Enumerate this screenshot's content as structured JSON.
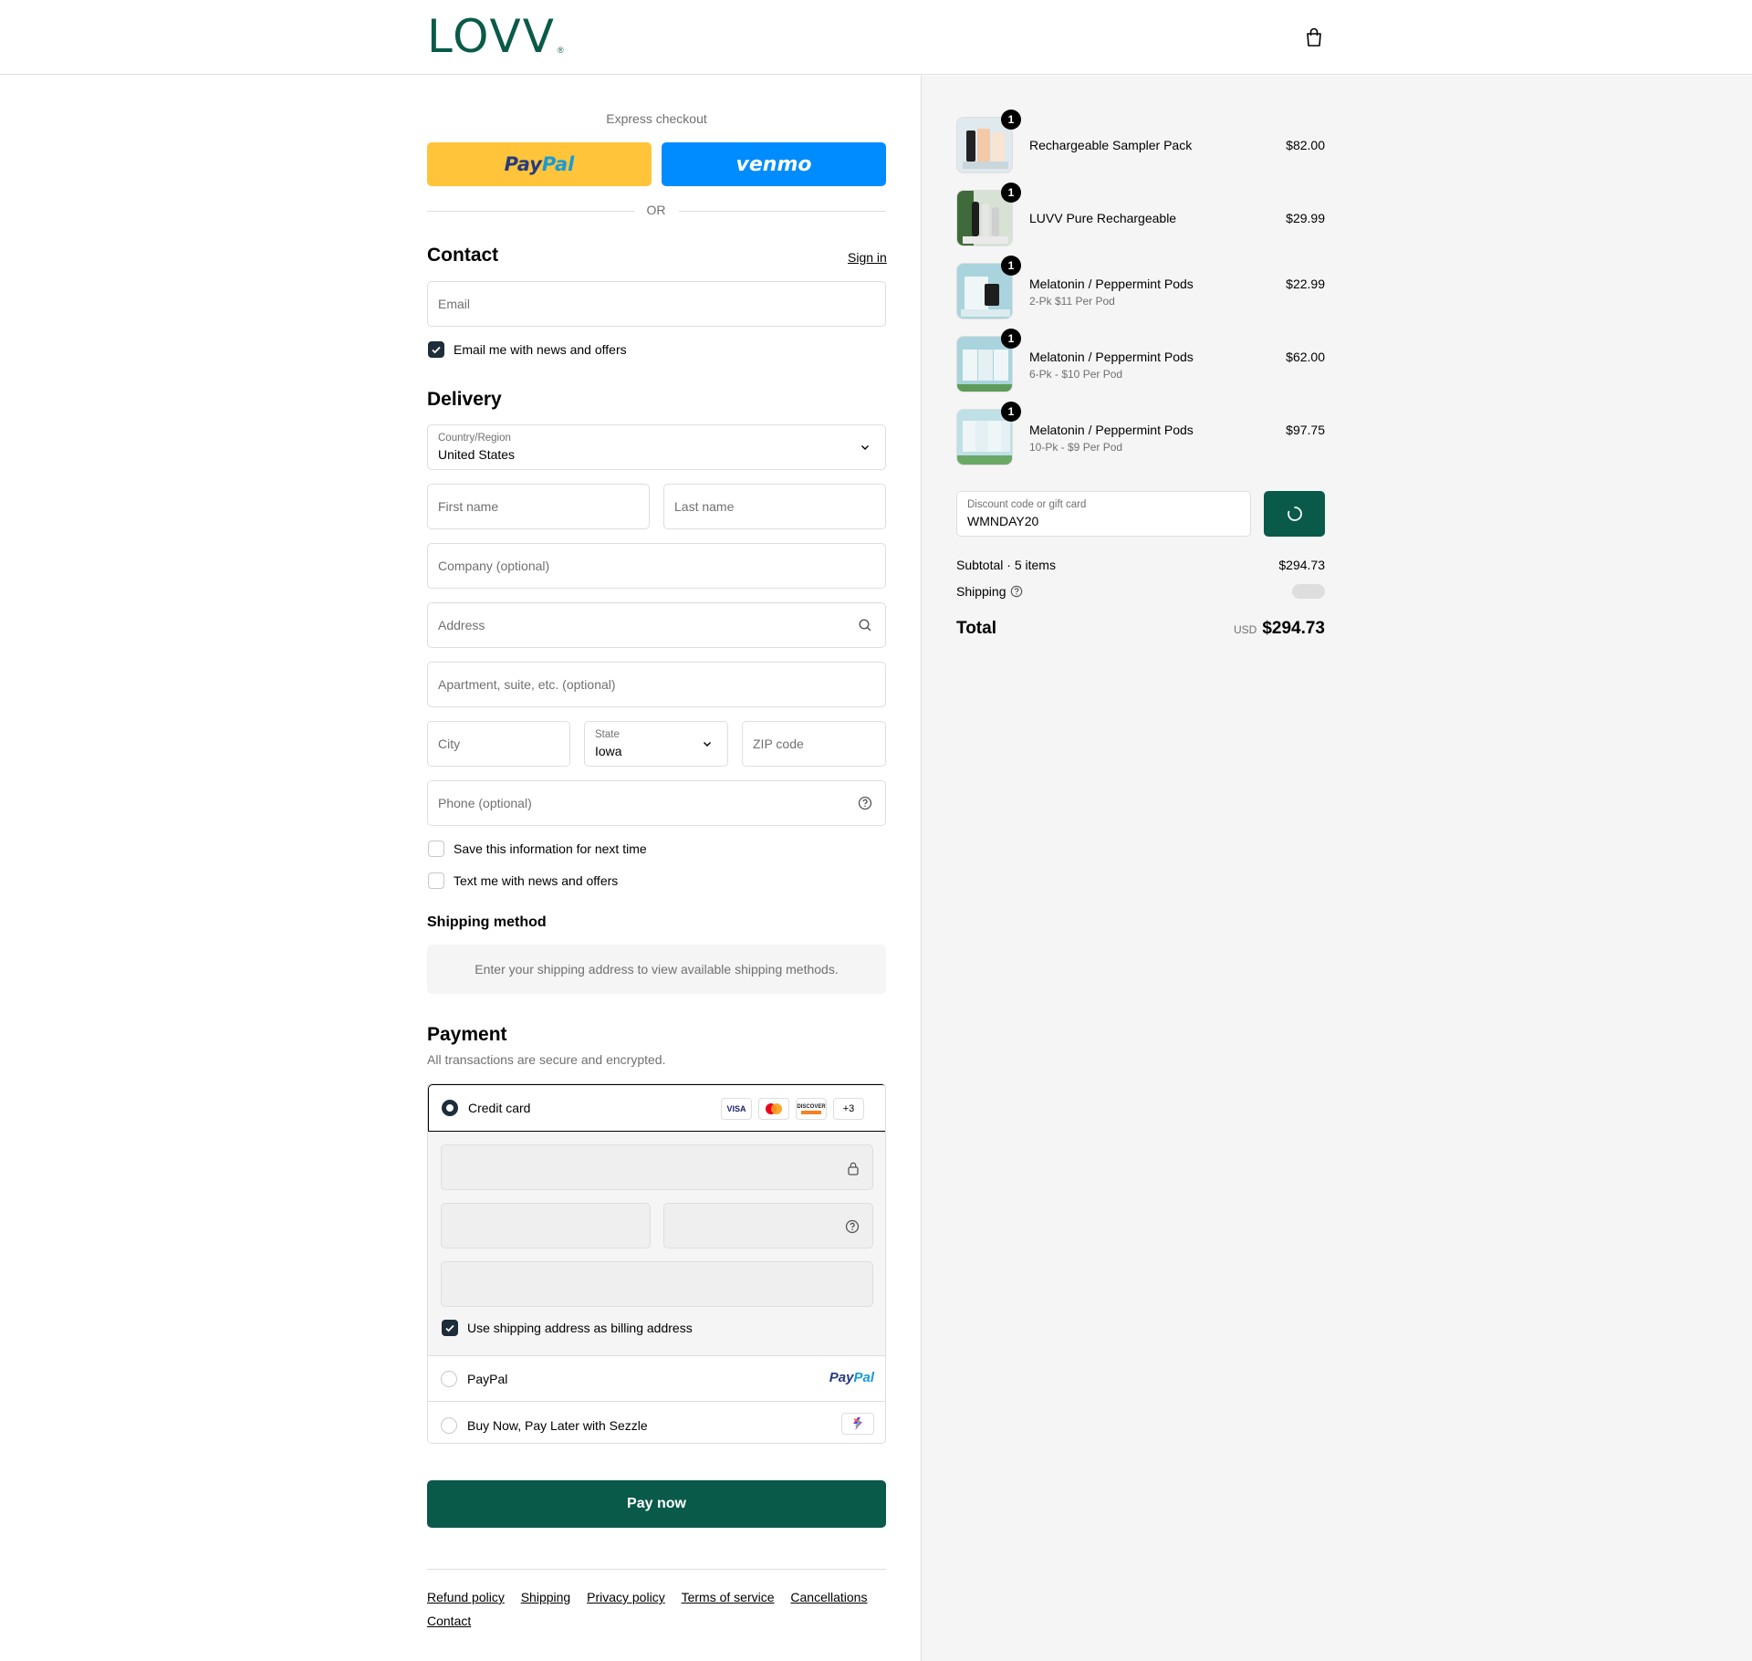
{
  "brand": {
    "logo": "LOVV",
    "reg": "®",
    "accent": "#0a5a49"
  },
  "express": {
    "title": "Express checkout",
    "paypal_a": "Pay",
    "paypal_b": "Pal",
    "venmo": "venmo",
    "or": "OR"
  },
  "contact": {
    "title": "Contact",
    "sign_in": "Sign in",
    "email_placeholder": "Email",
    "news_label": "Email me with news and offers"
  },
  "delivery": {
    "title": "Delivery",
    "country_label": "Country/Region",
    "country_value": "United States",
    "first_name": "First name",
    "last_name": "Last name",
    "company": "Company (optional)",
    "address": "Address",
    "apartment": "Apartment, suite, etc. (optional)",
    "city": "City",
    "state_label": "State",
    "state_value": "Iowa",
    "zip": "ZIP code",
    "phone": "Phone (optional)",
    "save_info": "Save this information for next time",
    "text_news": "Text me with news and offers"
  },
  "shipping_method": {
    "title": "Shipping method",
    "notice": "Enter your shipping address to view available shipping methods."
  },
  "payment": {
    "title": "Payment",
    "subtitle": "All transactions are secure and encrypted.",
    "credit_card": "Credit card",
    "brands": [
      "VISA",
      "",
      "DISCOVER",
      "+3"
    ],
    "billing_same": "Use shipping address as billing address",
    "paypal": "PayPal",
    "paypal_logo_a": "Pay",
    "paypal_logo_b": "Pal",
    "sezzle": "Buy Now, Pay Later with Sezzle"
  },
  "pay_now": "Pay now",
  "footer": [
    "Refund policy",
    "Shipping",
    "Privacy policy",
    "Terms of service",
    "Cancellations",
    "Contact"
  ],
  "order": {
    "items": [
      {
        "name": "Rechargeable Sampler Pack",
        "variant": "",
        "price": "$82.00",
        "qty": "1"
      },
      {
        "name": "LUVV Pure Rechargeable",
        "variant": "",
        "price": "$29.99",
        "qty": "1"
      },
      {
        "name": "Melatonin / Peppermint Pods",
        "variant": "2-Pk $11 Per Pod",
        "price": "$22.99",
        "qty": "1"
      },
      {
        "name": "Melatonin / Peppermint Pods",
        "variant": "6-Pk - $10 Per Pod",
        "price": "$62.00",
        "qty": "1"
      },
      {
        "name": "Melatonin / Peppermint Pods",
        "variant": "10-Pk - $9 Per Pod",
        "price": "$97.75",
        "qty": "1"
      }
    ],
    "discount_label": "Discount code or gift card",
    "discount_value": "WMNDAY20",
    "subtotal_label": "Subtotal · 5 items",
    "subtotal_value": "$294.73",
    "shipping_label": "Shipping",
    "total_label": "Total",
    "currency": "USD",
    "total_value": "$294.73"
  }
}
